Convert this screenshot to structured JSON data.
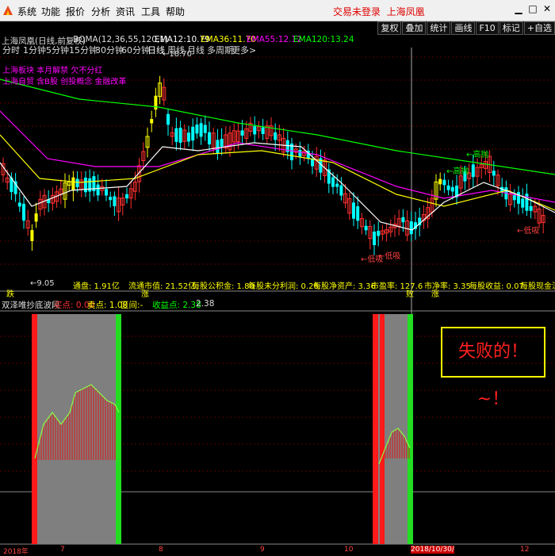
{
  "menu": {
    "items": [
      "系统",
      "功能",
      "报价",
      "分析",
      "资讯",
      "工具",
      "帮助"
    ],
    "login_status": "交易未登录",
    "stock_title": "上海凤凰"
  },
  "toolbar_right": [
    "复权",
    "叠加",
    "统计",
    "画线",
    "F10",
    "标记",
    "+自选"
  ],
  "period_tabs": [
    "分时",
    "1分钟",
    "5分钟",
    "15分钟",
    "30分钟",
    "60分钟",
    "日线",
    "周线",
    "月线",
    "多周期",
    "更多>"
  ],
  "active_tab": "日线",
  "ma_header": {
    "title": "上海凤凰(日线,前复权)",
    "indicator": "BQMA(12,36,55,120,1)",
    "ema12_label": "EMA12:",
    "ema12": "10.79",
    "ema36_label": "EMA36:",
    "ema36": "11.70",
    "ema55_label": "EMA55:",
    "ema55": "12.12",
    "ema120_label": "EMA120:",
    "ema120": "13.24"
  },
  "colors": {
    "ema12": "#ffffff",
    "ema36": "#ffff00",
    "ema55": "#ff00ff",
    "ema120": "#00ff00",
    "up": "#ff3030",
    "down": "#00ffff",
    "yellow_bar": "#ffff00"
  },
  "annotations": {
    "high_price": "18.70",
    "low_price": "9.05",
    "news1": "上海板块 本月解禁 欠不分红",
    "news2": "上海自贸 含B股 创投概念 金融改革",
    "gaopao1": "高抛",
    "gaopao2": "高抛",
    "dixi1": "低吸",
    "dixi2": "低吸",
    "dixi3": "低吸",
    "die": "跌",
    "zhang": "涨",
    "bai": "败",
    "die2": "涨"
  },
  "stats": {
    "liutong": "通盘: 1.91亿",
    "liutong_mv": "流通市值: 21.52亿",
    "gongjijin": "每股公积金: 1.80",
    "weifenpei": "每股未分利润: 0.26",
    "jingzichan": "每股净资产: 3.36",
    "pe": "市盈率: 127.6",
    "pb": "市净率: 3.35",
    "shouyi": "每股收益: 0.07",
    "xianjin": "每股现金流"
  },
  "indicator_header": {
    "name": "双泽唯抄底波段",
    "buy_label": "买点:",
    "buy_value": "0.00",
    "sell_label": "卖点:",
    "sell_value": "1.00",
    "range_label": "区间:",
    "range_value": "-",
    "profit_label": "收益点:",
    "profit_value": "2.38",
    "extra_value": "2.38"
  },
  "fail_text": "失败的！~！",
  "date_axis": [
    "2018年",
    "7",
    "8",
    "9",
    "10",
    "2018/10/30/",
    "12"
  ]
}
